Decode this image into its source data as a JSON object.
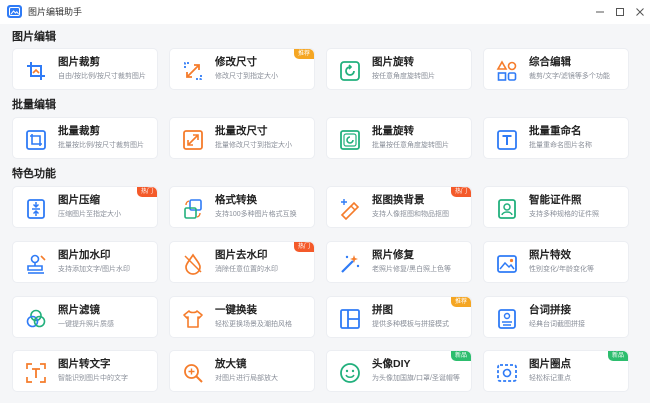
{
  "window": {
    "title": "图片编辑助手",
    "controls": {
      "minimize": "─",
      "maximize": "☐",
      "close": "✕"
    }
  },
  "sections": [
    {
      "title": "图片编辑",
      "cards": [
        {
          "title": "图片裁剪",
          "desc": "自由/按比例/按尺寸裁剪图片",
          "icon": "crop-icon",
          "badge": ""
        },
        {
          "title": "修改尺寸",
          "desc": "修改尺寸到指定大小",
          "icon": "resize-icon",
          "badge": "推荐"
        },
        {
          "title": "图片旋转",
          "desc": "按任意角度旋转图片",
          "icon": "rotate-icon",
          "badge": ""
        },
        {
          "title": "综合编辑",
          "desc": "裁剪/文字/滤镜等多个功能",
          "icon": "shapes-icon",
          "badge": ""
        }
      ]
    },
    {
      "title": "批量编辑",
      "cards": [
        {
          "title": "批量裁剪",
          "desc": "批量按比例/按尺寸裁剪图片",
          "icon": "batch-crop-icon",
          "badge": ""
        },
        {
          "title": "批量改尺寸",
          "desc": "批量修改尺寸到指定大小",
          "icon": "batch-resize-icon",
          "badge": ""
        },
        {
          "title": "批量旋转",
          "desc": "批量按任意角度旋转图片",
          "icon": "batch-rotate-icon",
          "badge": ""
        },
        {
          "title": "批量重命名",
          "desc": "批量重命名图片名称",
          "icon": "rename-icon",
          "badge": ""
        }
      ]
    },
    {
      "title": "特色功能",
      "cards": [
        {
          "title": "图片压缩",
          "desc": "压缩图片至指定大小",
          "icon": "compress-icon",
          "badge": "热门"
        },
        {
          "title": "格式转换",
          "desc": "支持100多种图片格式互换",
          "icon": "convert-icon",
          "badge": ""
        },
        {
          "title": "抠图换背景",
          "desc": "支持人像抠图和物品抠图",
          "icon": "cutout-icon",
          "badge": "热门"
        },
        {
          "title": "智能证件照",
          "desc": "支持多种规格的证件照",
          "icon": "id-photo-icon",
          "badge": ""
        },
        {
          "title": "图片加水印",
          "desc": "支持添加文字/图片水印",
          "icon": "stamp-icon",
          "badge": ""
        },
        {
          "title": "图片去水印",
          "desc": "消除任意位置的水印",
          "icon": "drop-icon",
          "badge": "热门"
        },
        {
          "title": "照片修复",
          "desc": "老照片修复/黑白照上色等",
          "icon": "magic-wand-icon",
          "badge": ""
        },
        {
          "title": "照片特效",
          "desc": "性别变化/年龄变化等",
          "icon": "image-effect-icon",
          "badge": ""
        },
        {
          "title": "照片滤镜",
          "desc": "一键提升照片质感",
          "icon": "filter-icon",
          "badge": ""
        },
        {
          "title": "一键换装",
          "desc": "轻松更换场景及潮拍风格",
          "icon": "shirt-icon",
          "badge": ""
        },
        {
          "title": "拼图",
          "desc": "提供多种模板与拼接模式",
          "icon": "collage-icon",
          "badge": "推荐"
        },
        {
          "title": "台词拼接",
          "desc": "经典台词截图拼接",
          "icon": "subtitle-icon",
          "badge": ""
        },
        {
          "title": "图片转文字",
          "desc": "智能识别图片中的文字",
          "icon": "ocr-icon",
          "badge": ""
        },
        {
          "title": "放大镜",
          "desc": "对图片进行局部放大",
          "icon": "magnifier-icon",
          "badge": ""
        },
        {
          "title": "头像DIY",
          "desc": "为头像加国旗/口罩/圣诞帽等",
          "icon": "smiley-icon",
          "badge": "新品"
        },
        {
          "title": "图片圈点",
          "desc": "轻松标记重点",
          "icon": "annotate-icon",
          "badge": "新品"
        }
      ]
    }
  ],
  "colors": {
    "blue": "#2f7bf6",
    "orange": "#f57c2b",
    "green": "#22b07d",
    "hot_badge": "#f45a2a",
    "recommend_badge": "#f5a623",
    "new_badge": "#2dbd6e"
  }
}
